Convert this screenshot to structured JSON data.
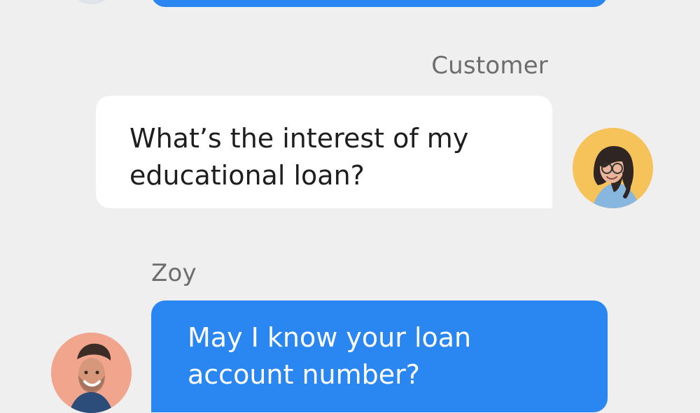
{
  "app": {
    "screen_name": "chat conversation"
  },
  "messages": [
    {
      "sender": "Customer",
      "text": "What’s the interest of my educational loan?"
    },
    {
      "sender": "Zoy",
      "text": "May I know your loan account number?"
    }
  ],
  "colors": {
    "background": "#efefef",
    "agent_bubble": "#2a86f0",
    "customer_bubble": "#ffffff",
    "meta_text": "#6d6d6d"
  }
}
